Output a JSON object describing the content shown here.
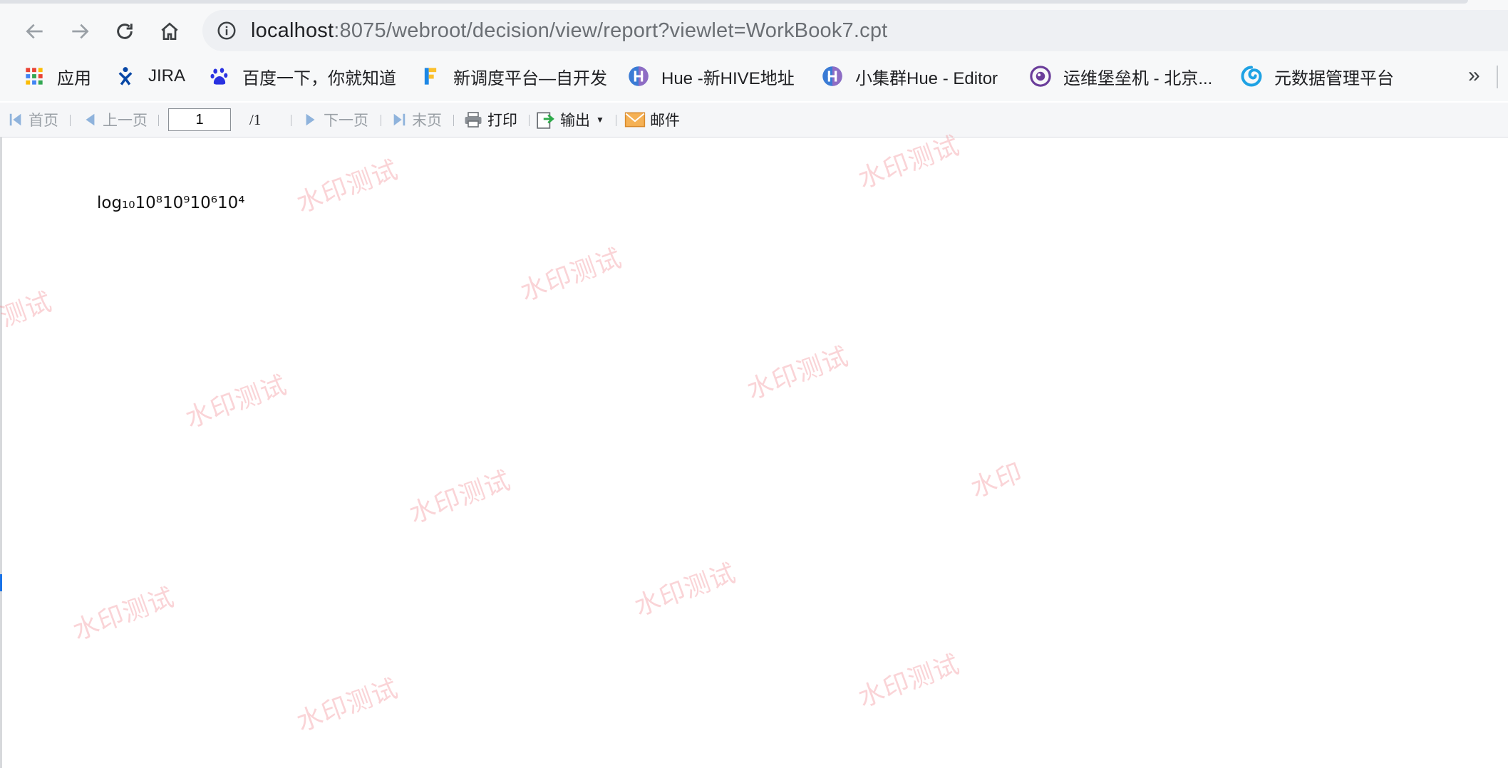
{
  "browser": {
    "url_host": "localhost",
    "url_path": ":8075/webroot/decision/view/report?viewlet=WorkBook7.cpt"
  },
  "bookmarks": [
    {
      "label": "应用",
      "icon": "apps-grid-icon",
      "color": "#ea4335"
    },
    {
      "label": "JIRA",
      "icon": "jira-icon",
      "color": "#0747a6"
    },
    {
      "label": "百度一下，你就知道",
      "icon": "baidu-paw-icon",
      "color": "#2932e1"
    },
    {
      "label": "新调度平台—自开发",
      "icon": "f-logo-icon",
      "color": "#1e88e5"
    },
    {
      "label": "Hue -新HIVE地址",
      "icon": "hue-icon",
      "color": "#3a7bd5"
    },
    {
      "label": "小集群Hue - Editor",
      "icon": "hue-icon",
      "color": "#3a7bd5"
    },
    {
      "label": "运维堡垒机 - 北京...",
      "icon": "eye-logo-icon",
      "color": "#6a3d9a"
    },
    {
      "label": "元数据管理平台",
      "icon": "swirl-logo-icon",
      "color": "#1ea2e4"
    }
  ],
  "bookmarks_more": "»",
  "toolbar": {
    "first": "首页",
    "prev": "上一页",
    "page_value": "1",
    "page_total": "/1",
    "next": "下一页",
    "last": "末页",
    "print": "打印",
    "export": "输出",
    "email": "邮件"
  },
  "report": {
    "text": "log₁₀10⁸10⁹10⁶10⁴"
  },
  "watermark_text": "水印测试",
  "watermark_partial_1": "测试",
  "watermark_partial_2": "水印",
  "watermark_partial_3": "水印测试"
}
